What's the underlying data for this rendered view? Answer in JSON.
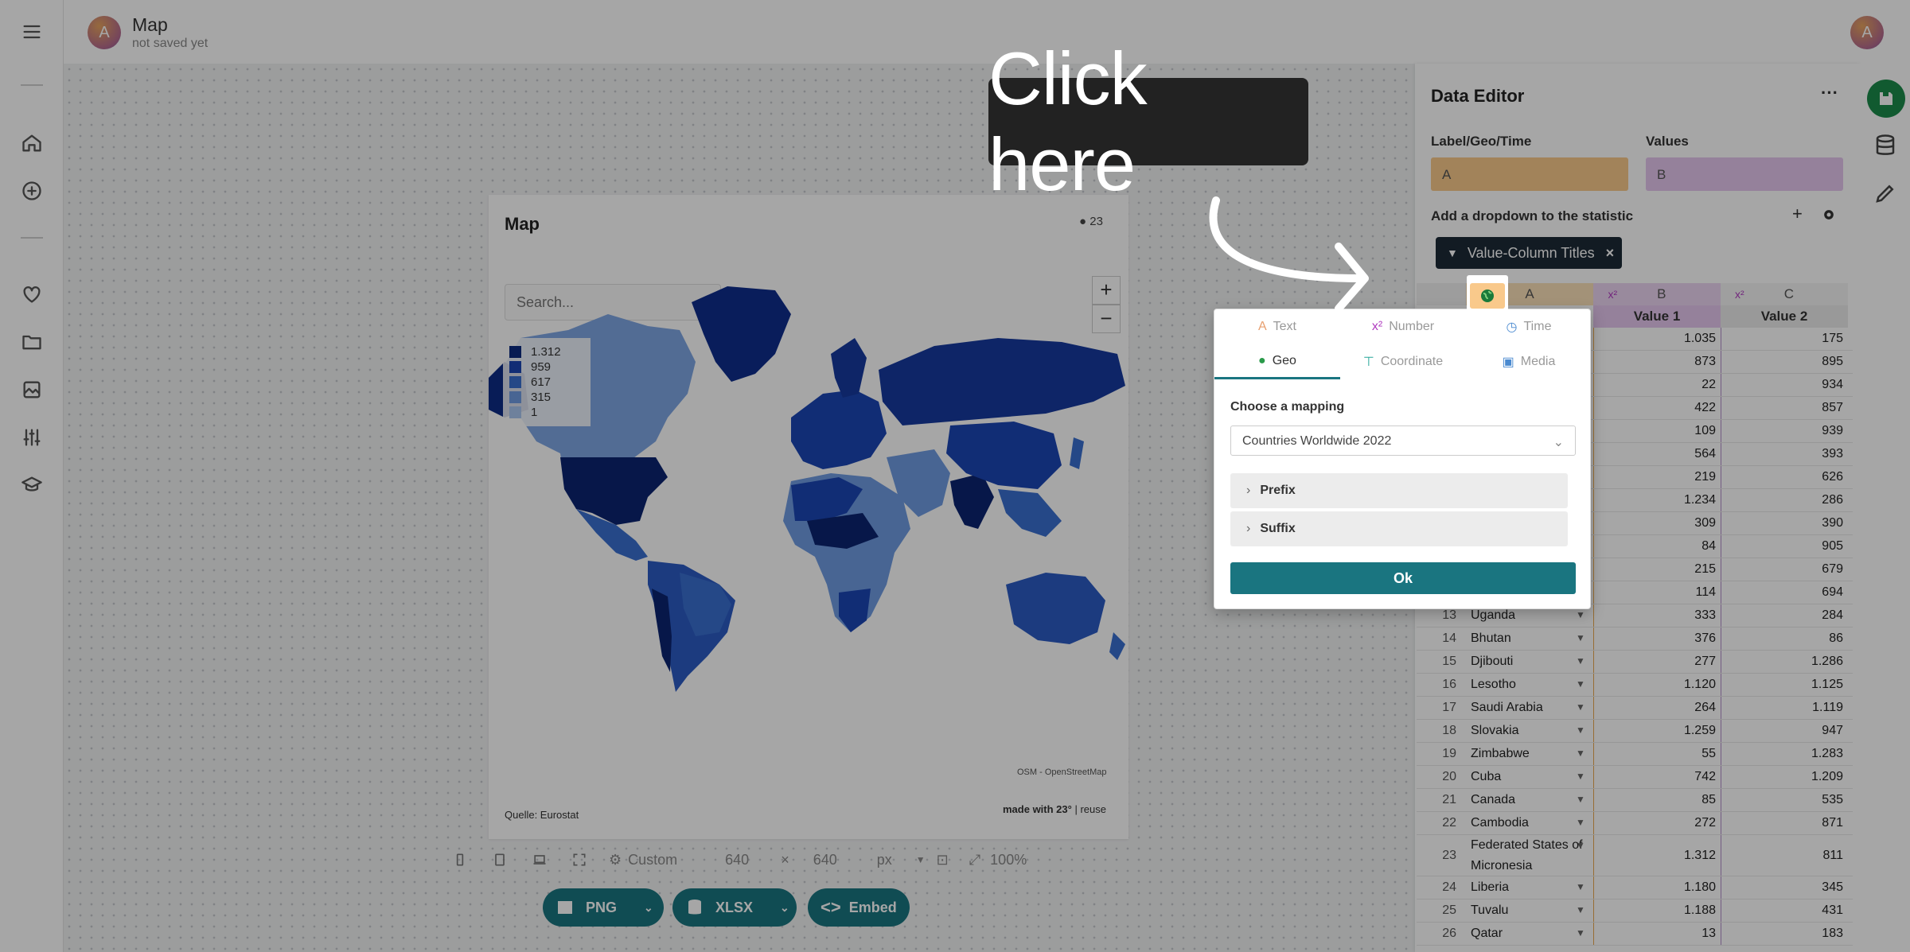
{
  "app": {
    "doc_title": "Map",
    "doc_status": "not saved yet",
    "avatar_letter": "A"
  },
  "sidebar": {
    "items": [
      "menu-icon",
      "home-icon",
      "plus-circle-icon",
      "heart-icon",
      "folder-icon",
      "image-icon",
      "sliders-icon",
      "graduation-cap-icon"
    ]
  },
  "map": {
    "title": "Map",
    "badge": "23",
    "search_placeholder": "Search...",
    "zoom_in": "+",
    "zoom_out": "−",
    "legend": [
      {
        "label": "1.312",
        "color": "#0b2a80"
      },
      {
        "label": "959",
        "color": "#1b45b4"
      },
      {
        "label": "617",
        "color": "#3a6fd0"
      },
      {
        "label": "315",
        "color": "#6f9be2"
      },
      {
        "label": "1",
        "color": "#a9c6f0"
      }
    ],
    "attribution": "OSM - OpenStreetMap",
    "source": "Quelle: Eurostat",
    "made_with": "made with 23°",
    "reuse": "reuse"
  },
  "toolbar": {
    "size_mode": "Custom",
    "width": "640",
    "times": "×",
    "height": "640",
    "unit": "px",
    "zoom": "100%"
  },
  "exports": {
    "png": "PNG",
    "xlsx": "XLSX",
    "embed": "Embed"
  },
  "editor": {
    "title": "Data Editor",
    "more": "···",
    "label_geo_time": "Label/Geo/Time",
    "values": "Values",
    "field_a": "A",
    "field_b": "B",
    "dropdown_label": "Add a dropdown to the statistic",
    "plus": "+",
    "chip_label": "Value-Column Titles",
    "chip_close": "×",
    "col_a": "A",
    "col_b": "B",
    "col_c": "C",
    "col_b_type": "x²",
    "col_c_type": "x²",
    "value1_header": "Value 1",
    "value2_header": "Value 2",
    "rows": [
      {
        "n": "",
        "label": "",
        "v1": "1.035",
        "v2": "175"
      },
      {
        "n": "",
        "label": "",
        "v1": "873",
        "v2": "895"
      },
      {
        "n": "",
        "label": "",
        "v1": "22",
        "v2": "934"
      },
      {
        "n": "",
        "label": "",
        "v1": "422",
        "v2": "857"
      },
      {
        "n": "",
        "label": "",
        "v1": "109",
        "v2": "939"
      },
      {
        "n": "",
        "label": "",
        "v1": "564",
        "v2": "393"
      },
      {
        "n": "",
        "label": "",
        "v1": "219",
        "v2": "626"
      },
      {
        "n": "",
        "label": "",
        "v1": "1.234",
        "v2": "286"
      },
      {
        "n": "",
        "label": "",
        "v1": "309",
        "v2": "390"
      },
      {
        "n": "",
        "label": "",
        "v1": "84",
        "v2": "905"
      },
      {
        "n": "",
        "label": "",
        "v1": "215",
        "v2": "679"
      },
      {
        "n": "",
        "label": "",
        "v1": "114",
        "v2": "694"
      },
      {
        "n": "13",
        "label": "Uganda",
        "v1": "333",
        "v2": "284"
      },
      {
        "n": "14",
        "label": "Bhutan",
        "v1": "376",
        "v2": "86"
      },
      {
        "n": "15",
        "label": "Djibouti",
        "v1": "277",
        "v2": "1.286"
      },
      {
        "n": "16",
        "label": "Lesotho",
        "v1": "1.120",
        "v2": "1.125"
      },
      {
        "n": "17",
        "label": "Saudi Arabia",
        "v1": "264",
        "v2": "1.119"
      },
      {
        "n": "18",
        "label": "Slovakia",
        "v1": "1.259",
        "v2": "947"
      },
      {
        "n": "19",
        "label": "Zimbabwe",
        "v1": "55",
        "v2": "1.283"
      },
      {
        "n": "20",
        "label": "Cuba",
        "v1": "742",
        "v2": "1.209"
      },
      {
        "n": "21",
        "label": "Canada",
        "v1": "85",
        "v2": "535"
      },
      {
        "n": "22",
        "label": "Cambodia",
        "v1": "272",
        "v2": "871"
      },
      {
        "n": "23",
        "label": "Federated States of Micronesia",
        "v1": "1.312",
        "v2": "811"
      },
      {
        "n": "24",
        "label": "Liberia",
        "v1": "1.180",
        "v2": "345"
      },
      {
        "n": "25",
        "label": "Tuvalu",
        "v1": "1.188",
        "v2": "431"
      },
      {
        "n": "26",
        "label": "Qatar",
        "v1": "13",
        "v2": "183"
      }
    ]
  },
  "popover": {
    "tabs": [
      {
        "label": "Text",
        "icon": "A"
      },
      {
        "label": "Number",
        "icon": "x²"
      },
      {
        "label": "Time",
        "icon": "◷"
      },
      {
        "label": "Geo",
        "icon": "●"
      },
      {
        "label": "Coordinate",
        "icon": "⊤"
      },
      {
        "label": "Media",
        "icon": "▣"
      }
    ],
    "mapping_label": "Choose a mapping",
    "mapping_value": "Countries Worldwide 2022",
    "prefix": "Prefix",
    "suffix": "Suffix",
    "ok": "Ok"
  },
  "tutorial": {
    "callout": "Click here"
  }
}
